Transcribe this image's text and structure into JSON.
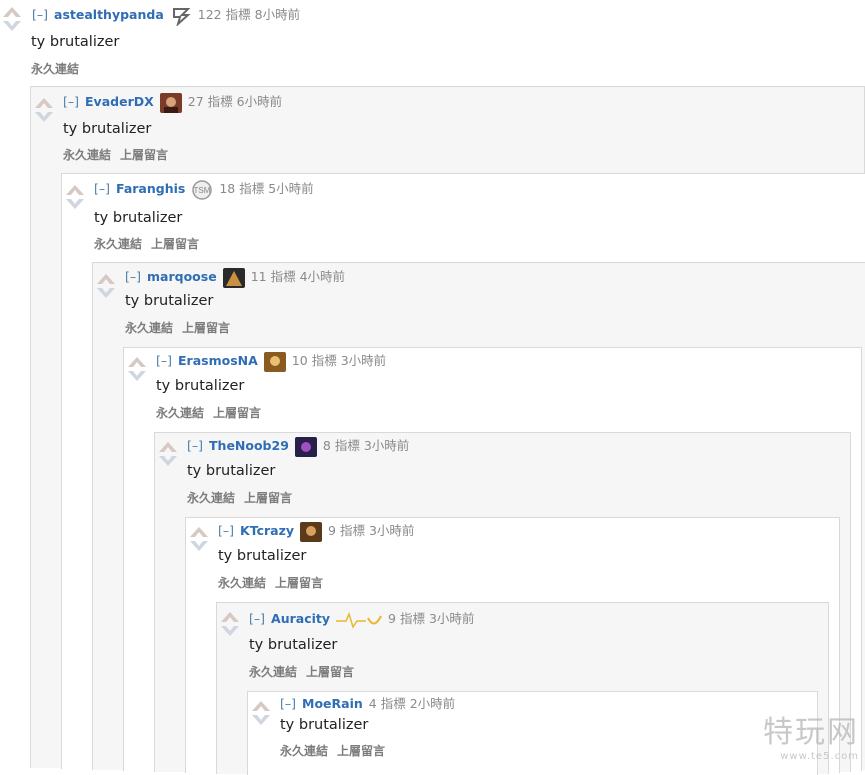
{
  "ui": {
    "expand": "[–]",
    "permalink": "永久連結",
    "parent": "上層留言",
    "points_word": "指標"
  },
  "comments": [
    {
      "author": "astealthypanda",
      "flair": "sk-logo-icon",
      "score": "122",
      "time": "8小時前",
      "body": "ty brutalizer"
    },
    {
      "author": "EvaderDX",
      "flair": "champion-avatar-icon",
      "score": "27",
      "time": "6小時前",
      "body": "ty brutalizer"
    },
    {
      "author": "Faranghis",
      "flair": "tsm-logo-icon",
      "score": "18",
      "time": "5小時前",
      "body": "ty brutalizer"
    },
    {
      "author": "marqoose",
      "flair": "champion-avatar-icon",
      "score": "11",
      "time": "4小時前",
      "body": "ty brutalizer"
    },
    {
      "author": "ErasmosNA",
      "flair": "champion-avatar-icon",
      "score": "10",
      "time": "3小時前",
      "body": "ty brutalizer"
    },
    {
      "author": "TheNoob29",
      "flair": "champion-avatar-icon",
      "score": "8",
      "time": "3小時前",
      "body": "ty brutalizer"
    },
    {
      "author": "KTcrazy",
      "flair": "champion-avatar-icon",
      "score": "9",
      "time": "3小時前",
      "body": "ty brutalizer"
    },
    {
      "author": "Auracity",
      "flair": "heartbeat-flair-icon",
      "score": "9",
      "time": "3小時前",
      "body": "ty brutalizer"
    },
    {
      "author": "MoeRain",
      "flair": "",
      "score": "4",
      "time": "2小時前",
      "body": "ty brutalizer"
    }
  ],
  "watermark": {
    "text": "特玩网",
    "sub": "www.te5.com"
  }
}
